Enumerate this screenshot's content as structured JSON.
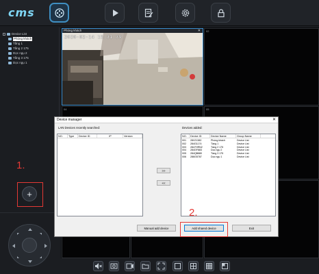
{
  "app": {
    "logo": "cms"
  },
  "topnav": [
    {
      "icon": "film-reel-icon",
      "active": true
    },
    {
      "icon": "play-icon",
      "active": false
    },
    {
      "icon": "edit-doc-icon",
      "active": false
    },
    {
      "icon": "gear-icon",
      "active": false
    },
    {
      "icon": "lock-icon",
      "active": false
    }
  ],
  "tree": {
    "root": "Device List",
    "items": [
      "Phòng khách",
      "Tầng 1",
      "Tầng 2 175",
      "Dọc ngụ 2",
      "Tầng 3 175",
      "Dọc ngụ 1"
    ],
    "selected": "Phòng khách"
  },
  "annotations": {
    "step1": "1.",
    "step2": "2."
  },
  "cells": {
    "live": {
      "title": "Phòng khách",
      "osd": "2020-02-14  15:31:39",
      "close": "✕"
    },
    "c02": "02",
    "c04": "04",
    "c05": "05",
    "c06": "06",
    "c08": "08",
    "c09": "09"
  },
  "dialog": {
    "title": "Device manager",
    "close": "✕",
    "lan_label": "LAN Devices recently searched:",
    "lan_columns": [
      "NO.",
      "Type",
      "Device ID",
      "IP",
      "Version"
    ],
    "added_label": "Devices added:",
    "added_columns": [
      "NO.",
      "Device ID",
      "Device Name",
      "Group Name"
    ],
    "added_rows": [
      [
        "001",
        "28V21382",
        "Phòng khách",
        "Device List"
      ],
      [
        "002",
        "284G1174",
        "Tầng 1",
        "Device List"
      ],
      [
        "003",
        "2847HRN2",
        "Tầng 2 175",
        "Device List"
      ],
      [
        "004",
        "284GF883",
        "Dọc ngụ 2",
        "Device List"
      ],
      [
        "005",
        "284QB880",
        "Tầng 3 175",
        "Device List"
      ],
      [
        "006",
        "286G5787",
        "Dọc ngụ 1",
        "Device List"
      ]
    ],
    "move_right": ">>",
    "move_left": "<<",
    "manual_add": "Manual add device",
    "add_shared": "Add shared device",
    "exit": "Exit"
  }
}
